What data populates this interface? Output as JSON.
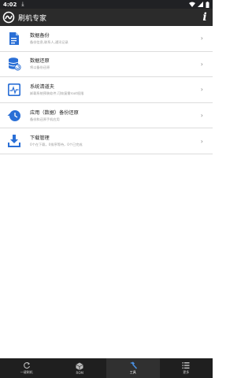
{
  "status_bar": {
    "time": "4:02",
    "download_glyph": "⤓"
  },
  "app_bar": {
    "title": "刷机专家",
    "info_label": "i"
  },
  "list": [
    {
      "icon": "document-backup-icon",
      "title": "数据备份",
      "subtitle": "备份信息,联系人,通讯记录",
      "color": "#2a6fd6"
    },
    {
      "icon": "database-restore-icon",
      "title": "数据还原",
      "subtitle": "将以备份还原",
      "color": "#2a6fd6"
    },
    {
      "icon": "system-clean-icon",
      "title": "系统清道夫",
      "subtitle": "卸载系统预装软件,可恢复需root权限",
      "color": "#2a6fd6"
    },
    {
      "icon": "app-backup-icon",
      "title": "应用（数据）备份还原",
      "subtitle": "备份和还原手机应用",
      "color": "#2a6fd6"
    },
    {
      "icon": "download-tray-icon",
      "title": "下载管理",
      "subtitle": "0个在下载，0排序等待，0个已完成",
      "color": "#2a6fd6"
    }
  ],
  "chevron": "›",
  "bottom_nav": [
    {
      "name": "tab-flash",
      "label": "一键刷机",
      "active": false
    },
    {
      "name": "tab-rom",
      "label": "ROM",
      "active": false
    },
    {
      "name": "tab-tools",
      "label": "工具",
      "active": true
    },
    {
      "name": "tab-more",
      "label": "更多",
      "active": false
    }
  ]
}
